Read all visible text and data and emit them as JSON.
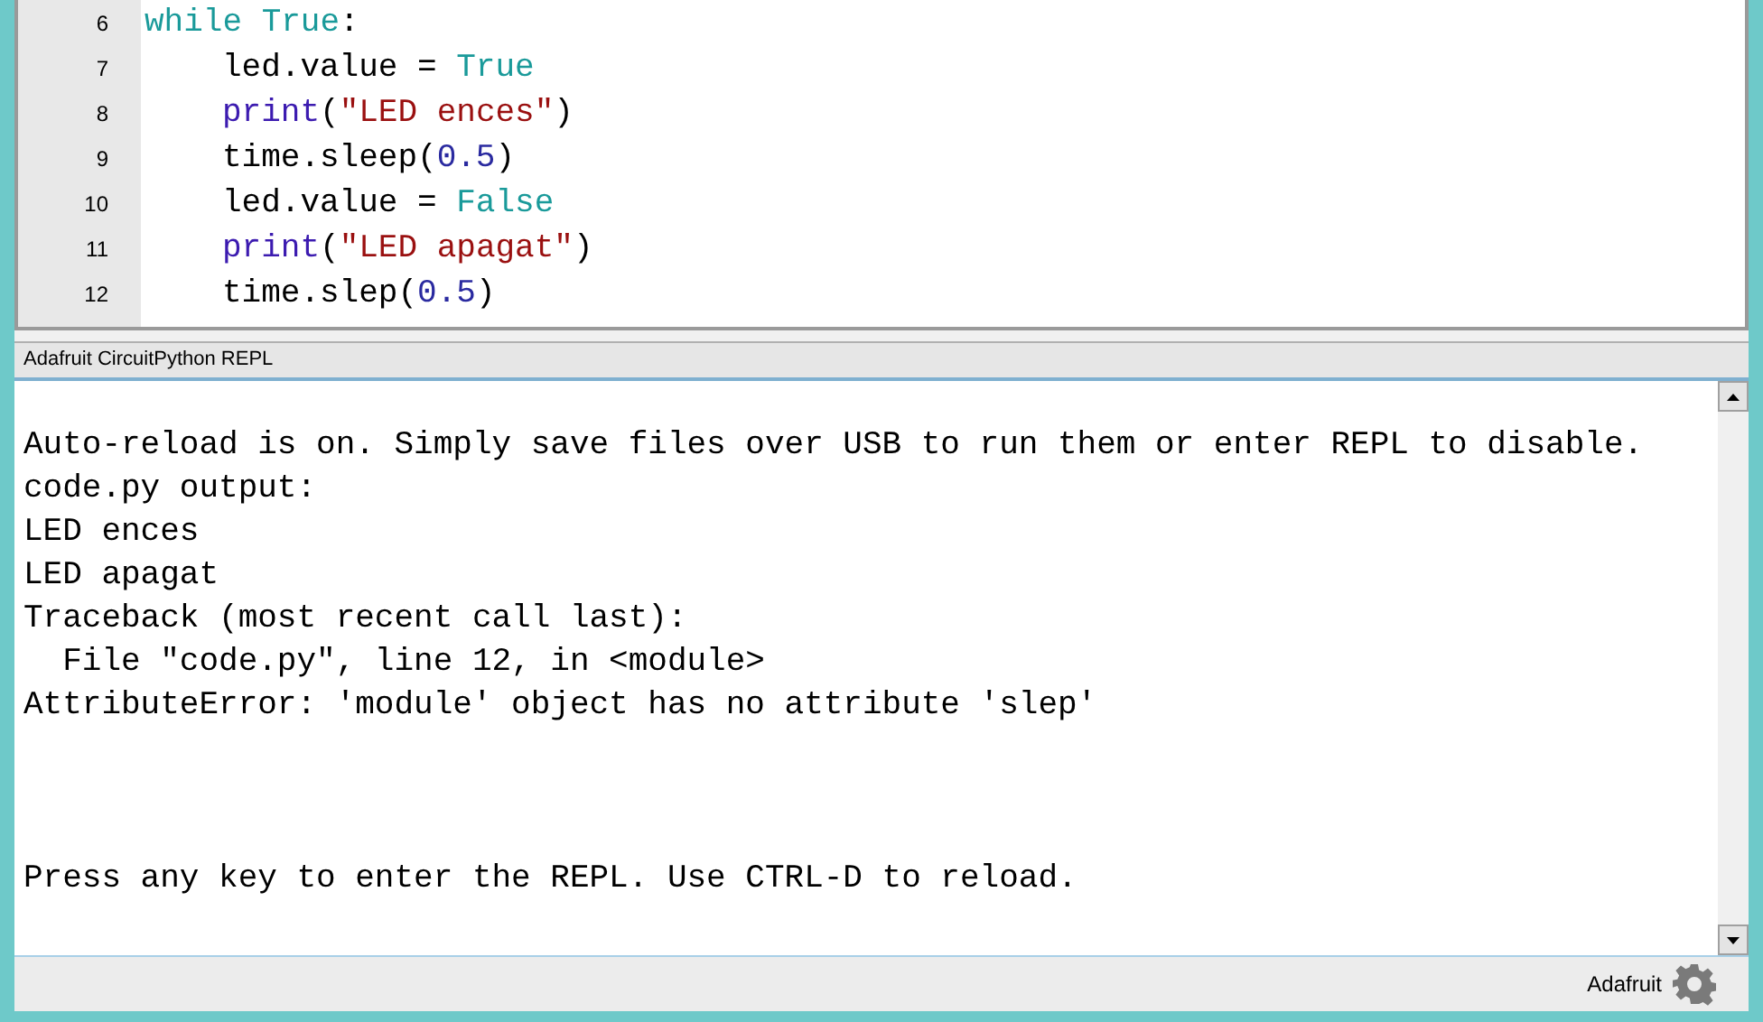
{
  "editor": {
    "lines": [
      {
        "number": "6",
        "indented": false,
        "tokens": [
          {
            "kind": "keyword",
            "text": "while "
          },
          {
            "kind": "constant",
            "text": "True"
          },
          {
            "kind": "plain",
            "text": ":"
          }
        ]
      },
      {
        "number": "7",
        "indented": true,
        "tokens": [
          {
            "kind": "plain",
            "text": "led.value = "
          },
          {
            "kind": "constant",
            "text": "True"
          }
        ]
      },
      {
        "number": "8",
        "indented": true,
        "tokens": [
          {
            "kind": "builtin",
            "text": "print"
          },
          {
            "kind": "plain",
            "text": "("
          },
          {
            "kind": "string",
            "text": "\"LED ences\""
          },
          {
            "kind": "plain",
            "text": ")"
          }
        ]
      },
      {
        "number": "9",
        "indented": true,
        "tokens": [
          {
            "kind": "plain",
            "text": "time.sleep("
          },
          {
            "kind": "number",
            "text": "0.5"
          },
          {
            "kind": "plain",
            "text": ")"
          }
        ]
      },
      {
        "number": "10",
        "indented": true,
        "tokens": [
          {
            "kind": "plain",
            "text": "led.value = "
          },
          {
            "kind": "constant",
            "text": "False"
          }
        ]
      },
      {
        "number": "11",
        "indented": true,
        "tokens": [
          {
            "kind": "builtin",
            "text": "print"
          },
          {
            "kind": "plain",
            "text": "("
          },
          {
            "kind": "string",
            "text": "\"LED apagat\""
          },
          {
            "kind": "plain",
            "text": ")"
          }
        ]
      },
      {
        "number": "12",
        "indented": true,
        "tokens": [
          {
            "kind": "plain",
            "text": "time.slep("
          },
          {
            "kind": "number",
            "text": "0.5"
          },
          {
            "kind": "plain",
            "text": ")"
          }
        ]
      }
    ]
  },
  "repl": {
    "title": "Adafruit CircuitPython REPL",
    "blocks": [
      [
        "Auto-reload is on. Simply save files over USB to run them or enter REPL to disable.",
        "code.py output:",
        "LED ences",
        "LED apagat",
        "Traceback (most recent call last):",
        "  File \"code.py\", line 12, in <module>",
        "AttributeError: 'module' object has no attribute 'slep'"
      ],
      [
        "Press any key to enter the REPL. Use CTRL-D to reload."
      ]
    ]
  },
  "status_bar": {
    "mode": "Adafruit"
  }
}
